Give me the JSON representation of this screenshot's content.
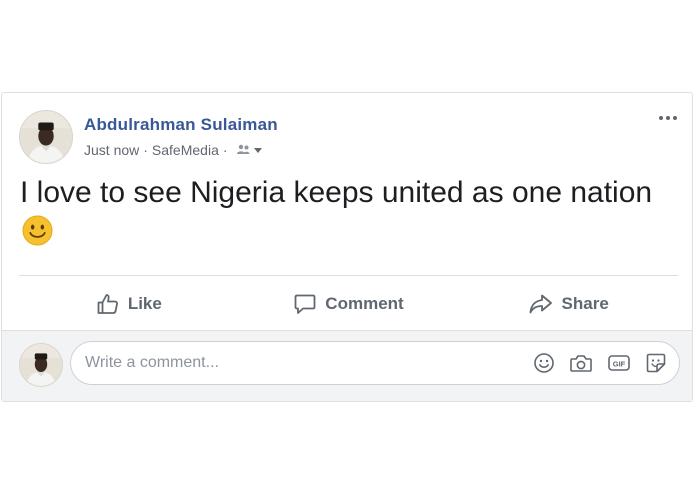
{
  "post": {
    "author_name": "Abdulrahman Sulaiman",
    "timestamp": "Just now",
    "separator": "·",
    "app_name": "SafeMedia",
    "audience_icon": "friends-icon",
    "text": "I love to see Nigeria keeps united as one nation",
    "emoji": "smile-emoji",
    "more_icon": "more-options-icon"
  },
  "actions": {
    "like_label": "Like",
    "comment_label": "Comment",
    "share_label": "Share"
  },
  "comment_box": {
    "placeholder": "Write a comment...",
    "tools": [
      "emoji-icon",
      "camera-icon",
      "gif-icon",
      "sticker-icon"
    ]
  },
  "colors": {
    "author_link": "#385898",
    "secondary_text": "#616770",
    "action_text": "#606770",
    "comment_bg": "#f2f3f5",
    "emoji_yellow": "#f7c02e"
  }
}
